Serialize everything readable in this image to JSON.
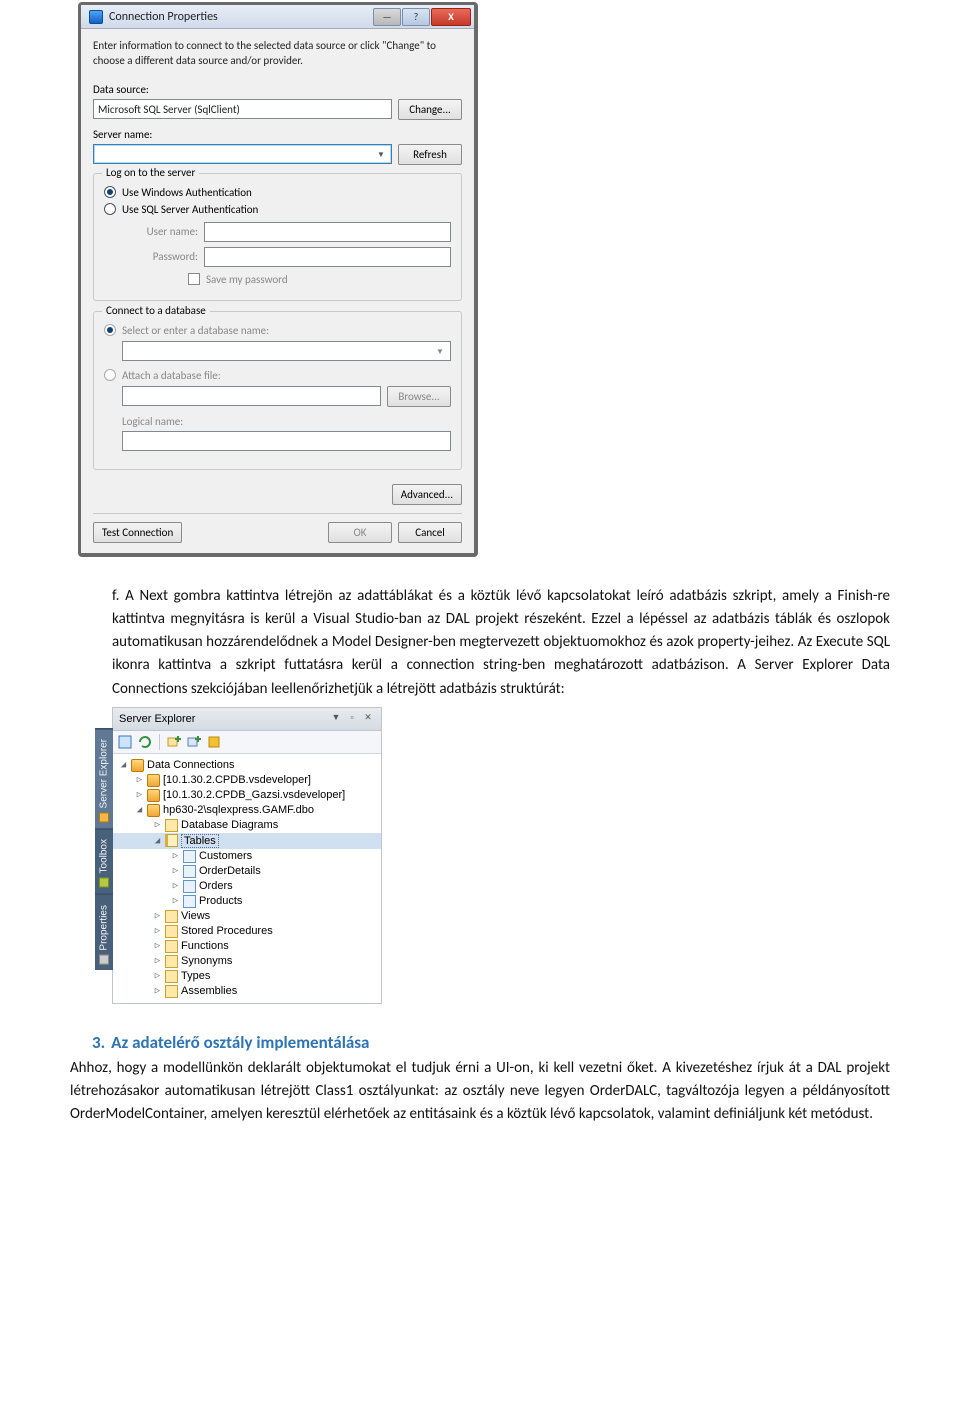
{
  "dialog": {
    "title": "Connection Properties",
    "intro": "Enter information to connect to the selected data source or click \"Change\" to choose a different data source and/or provider.",
    "dataSourceLabel": "Data source:",
    "dataSourceValue": "Microsoft SQL Server (SqlClient)",
    "changeBtn": "Change...",
    "serverNameLabel": "Server name:",
    "serverNameValue": "",
    "refreshBtn": "Refresh",
    "logonLegend": "Log on to the server",
    "radioWin": "Use Windows Authentication",
    "radioSql": "Use SQL Server Authentication",
    "userLabel": "User name:",
    "passLabel": "Password:",
    "savePass": "Save my password",
    "connectLegend": "Connect to a database",
    "radioDbName": "Select or enter a database name:",
    "radioAttach": "Attach a database file:",
    "browseBtn": "Browse...",
    "logicalLabel": "Logical name:",
    "advancedBtn": "Advanced...",
    "testBtn": "Test Connection",
    "okBtn": "OK",
    "cancelBtn": "Cancel",
    "titlebar": {
      "min": "—",
      "help": "?",
      "close": "X"
    }
  },
  "paragraphF": "f.  A Next gombra kattintva létrejön az adattáblákat és a köztük lévő kapcsolatokat leíró adatbázis szkript, amely a Finish-re kattintva megnyitásra is kerül a Visual Studio-ban az DAL projekt részeként. Ezzel a lépéssel az adatbázis táblák és oszlopok automatikusan hozzárendelődnek a Model Designer-ben megtervezett objektuomokhoz és azok property-jeihez. Az Execute SQL ikonra kattintva a szkript futtatásra kerül a connection string-ben meghatározott adatbázison. A Server Explorer Data Connections szekciójában leellenőrizhetjük a létrejött adatbázis struktúrát:",
  "explorer": {
    "sidetabs": [
      "Server Explorer",
      "Toolbox",
      "Properties"
    ],
    "title": "Server Explorer",
    "rootLabel": "Data Connections",
    "conn1": "[10.1.30.2.CPDB.vsdeveloper]",
    "conn2": "[10.1.30.2.CPDB_Gazsi.vsdeveloper]",
    "conn3": "hp630-2\\sqlexpress.GAMF.dbo",
    "folderDiagrams": "Database Diagrams",
    "folderTables": "Tables",
    "tableCustomers": "Customers",
    "tableOrderDetails": "OrderDetails",
    "tableOrders": "Orders",
    "tableProducts": "Products",
    "folderViews": "Views",
    "folderSP": "Stored Procedures",
    "folderFunctions": "Functions",
    "folderSynonyms": "Synonyms",
    "folderTypes": "Types",
    "folderAssemblies": "Assemblies"
  },
  "heading": {
    "num": "3.",
    "text": "Az adatelérő osztály implementálása"
  },
  "paragraph3": "Ahhoz, hogy a modellünkön deklarált objektumokat el tudjuk érni a UI-on, ki kell vezetni őket. A kivezetéshez írjuk át a DAL projekt létrehozásakor automatikusan létrejött Class1 osztályunkat: az osztály neve legyen OrderDALC, tagváltozója legyen a példányosított OrderModelContainer, amelyen keresztül elérhetőek az entitásaink és a köztük lévő kapcsolatok, valamint definiáljunk két metódust."
}
